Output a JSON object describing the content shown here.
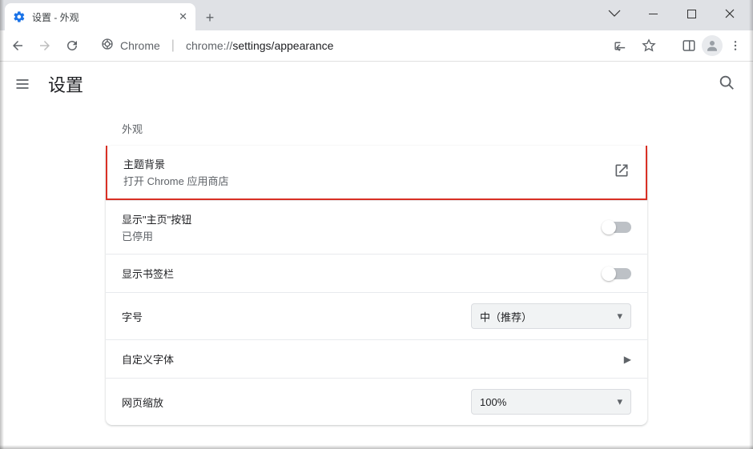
{
  "tab": {
    "title": "设置 - 外观"
  },
  "address": {
    "host": "Chrome",
    "pathPrefix": "chrome://",
    "pathBold": "settings/appearance"
  },
  "header": {
    "title": "设置"
  },
  "section": {
    "title": "外观"
  },
  "rows": {
    "theme": {
      "label": "主题背景",
      "sub": "打开 Chrome 应用商店"
    },
    "homeButton": {
      "label": "显示\"主页\"按钮",
      "sub": "已停用"
    },
    "bookmarkBar": {
      "label": "显示书签栏"
    },
    "fontSize": {
      "label": "字号",
      "value": "中（推荐）"
    },
    "customFont": {
      "label": "自定义字体"
    },
    "pageZoom": {
      "label": "网页缩放",
      "value": "100%"
    }
  }
}
